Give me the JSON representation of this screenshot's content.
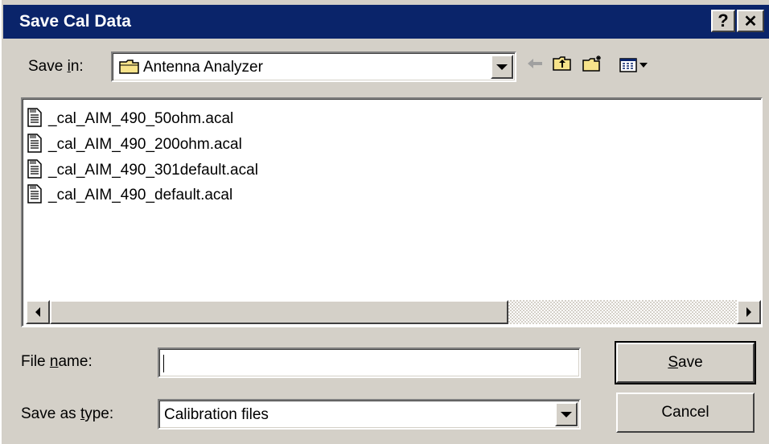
{
  "window": {
    "title": "Save Cal Data",
    "help_button": "?",
    "close_button": "✕"
  },
  "toolbar": {
    "save_in_label_prefix": "Save ",
    "save_in_label_accel": "i",
    "save_in_label_suffix": "n:",
    "save_in_value": "Antenna Analyzer",
    "back_icon": "back-arrow-icon",
    "up_folder_icon": "up-one-level-icon",
    "new_folder_icon": "create-new-folder-icon",
    "view_menu_icon": "view-menu-icon"
  },
  "files": [
    {
      "name": "_cal_AIM_490_50ohm.acal",
      "icon": "document-icon"
    },
    {
      "name": "_cal_AIM_490_200ohm.acal",
      "icon": "document-icon"
    },
    {
      "name": "_cal_AIM_490_301default.acal",
      "icon": "document-icon"
    },
    {
      "name": "_cal_AIM_490_default.acal",
      "icon": "document-icon"
    }
  ],
  "form": {
    "file_name_label_prefix": "File ",
    "file_name_label_accel": "n",
    "file_name_label_suffix": "ame:",
    "file_name_value": "",
    "save_as_type_label_prefix": "Save as ",
    "save_as_type_label_accel": "t",
    "save_as_type_label_suffix": "ype:",
    "save_as_type_value": "Calibration files"
  },
  "buttons": {
    "save_accel": "S",
    "save_rest": "ave",
    "cancel": "Cancel"
  },
  "colors": {
    "titlebar": "#0a246a",
    "face": "#d4d0c8",
    "folder": "#f7e38a"
  }
}
